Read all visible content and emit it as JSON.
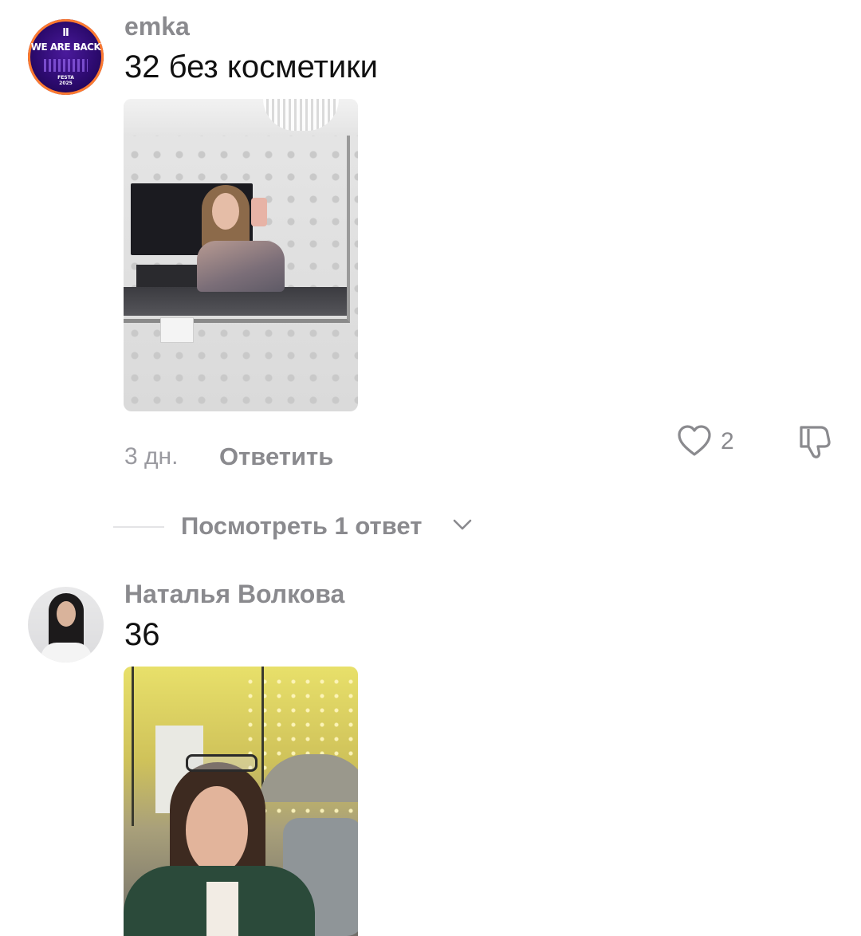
{
  "comments": [
    {
      "username": "emka",
      "text": "32 без косметики",
      "avatar_text": {
        "mark": "Ⅱ",
        "main": "WE ARE BACK",
        "sub_1": "FESTA",
        "sub_2": "2025"
      },
      "time": "3 дн.",
      "reply_label": "Ответить",
      "likes": "2",
      "view_replies_label": "Посмотреть 1 ответ"
    },
    {
      "username": "Наталья Волкова",
      "text": "36"
    }
  ],
  "icons": {
    "like": "heart-icon",
    "dislike": "thumbs-down-icon",
    "expand": "chevron-down-icon"
  },
  "colors": {
    "username": "#8a8a8e",
    "text": "#111111",
    "meta": "#9a9aa0",
    "avatar_bts_bg": "#2c0a6e",
    "avatar_bts_ring": "#ff7a2f"
  }
}
